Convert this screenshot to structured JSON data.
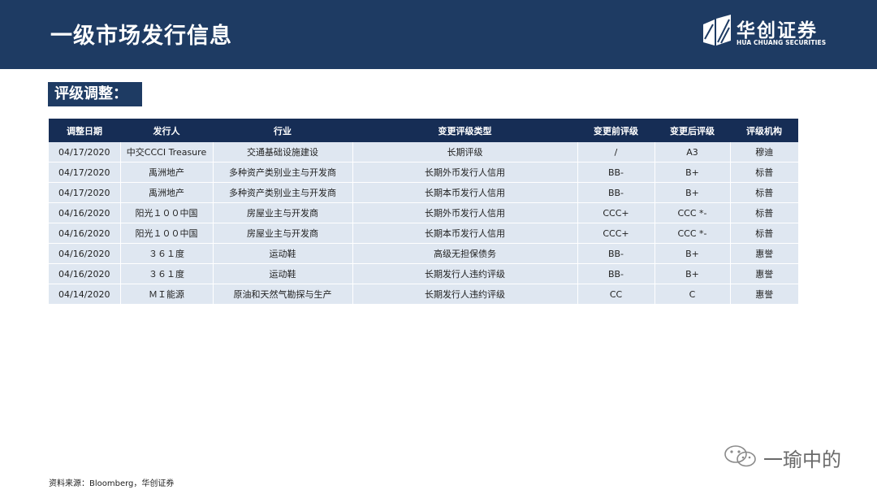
{
  "header": {
    "title": "一级市场发行信息",
    "logo_cn": "华创证券",
    "logo_en": "HUA CHUANG SECURITIES"
  },
  "section": {
    "label": "评级调整："
  },
  "table": {
    "columns": [
      "调整日期",
      "发行人",
      "行业",
      "变更评级类型",
      "变更前评级",
      "变更后评级",
      "评级机构"
    ],
    "rows": [
      [
        "04/17/2020",
        "中交CCCI Treasure",
        "交通基础设施建设",
        "长期评级",
        "/",
        "A3",
        "穆迪"
      ],
      [
        "04/17/2020",
        "禹洲地产",
        "多种资产类别业主与开发商",
        "长期外币发行人信用",
        "BB-",
        "B+",
        "标普"
      ],
      [
        "04/17/2020",
        "禹洲地产",
        "多种资产类别业主与开发商",
        "长期本币发行人信用",
        "BB-",
        "B+",
        "标普"
      ],
      [
        "04/16/2020",
        "阳光１００中国",
        "房屋业主与开发商",
        "长期外币发行人信用",
        "CCC+",
        "CCC *-",
        "标普"
      ],
      [
        "04/16/2020",
        "阳光１００中国",
        "房屋业主与开发商",
        "长期本币发行人信用",
        "CCC+",
        "CCC *-",
        "标普"
      ],
      [
        "04/16/2020",
        "３６１度",
        "运动鞋",
        "高级无担保债务",
        "BB-",
        "B+",
        "惠誉"
      ],
      [
        "04/16/2020",
        "３６１度",
        "运动鞋",
        "长期发行人违约评级",
        "BB-",
        "B+",
        "惠誉"
      ],
      [
        "04/14/2020",
        "ＭＩ能源",
        "原油和天然气勘探与生产",
        "长期发行人违约评级",
        "CC",
        "C",
        "惠誉"
      ]
    ]
  },
  "footer": {
    "source": "资料来源：Bloomberg，华创证券"
  },
  "watermark": {
    "text": "一瑜中的",
    "icon": "wechat-icon"
  },
  "colors": {
    "header_bg": "#1e3b63",
    "table_header_bg": "#162d55",
    "row_bg": "#dfe7f1"
  }
}
